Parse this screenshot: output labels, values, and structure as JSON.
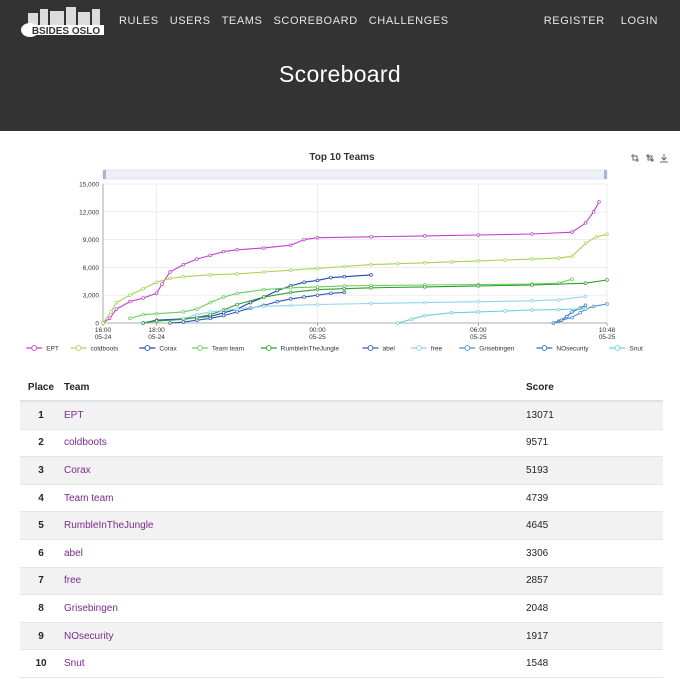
{
  "nav": {
    "left": [
      "RULES",
      "USERS",
      "TEAMS",
      "SCOREBOARD",
      "CHALLENGES"
    ],
    "right": [
      "REGISTER",
      "LOGIN"
    ]
  },
  "page_title": "Scoreboard",
  "logo": {
    "text": "BSIDES OSLO"
  },
  "table": {
    "headers": {
      "place": "Place",
      "team": "Team",
      "score": "Score"
    },
    "rows": [
      {
        "place": "1",
        "team": "EPT",
        "score": "13071"
      },
      {
        "place": "2",
        "team": "coldboots",
        "score": "9571"
      },
      {
        "place": "3",
        "team": "Corax",
        "score": "5193"
      },
      {
        "place": "4",
        "team": "Team team",
        "score": "4739"
      },
      {
        "place": "5",
        "team": "RumbleInTheJungle",
        "score": "4645"
      },
      {
        "place": "6",
        "team": "abel",
        "score": "3306"
      },
      {
        "place": "7",
        "team": "free",
        "score": "2857"
      },
      {
        "place": "8",
        "team": "Grisebingen",
        "score": "2048"
      },
      {
        "place": "9",
        "team": "NOsecurity",
        "score": "1917"
      },
      {
        "place": "10",
        "team": "Snut",
        "score": "1548"
      }
    ]
  },
  "colors": {
    "header_bg": "#333333",
    "link": "#7a2a8f",
    "stripe": "#f2f2f2"
  },
  "icons": [
    "zoom-icon",
    "zoom-reset-icon",
    "download-icon"
  ],
  "chart_data": {
    "type": "line",
    "title": "Top 10 Teams",
    "x_unit": "hours",
    "xlim": [
      0,
      18.8
    ],
    "ylim": [
      0,
      15000
    ],
    "y_ticks": [
      "0",
      "3,000",
      "6,000",
      "9,000",
      "12,000",
      "15,000"
    ],
    "y_tick_values": [
      0,
      3000,
      6000,
      9000,
      12000,
      15000
    ],
    "x_ticks": [
      {
        "x": 0,
        "time": "16:00",
        "date": "05-24"
      },
      {
        "x": 2,
        "time": "18:00",
        "date": "05-24"
      },
      {
        "x": 8,
        "time": "00:00",
        "date": "05-25"
      },
      {
        "x": 14,
        "time": "06:00",
        "date": "05-25"
      },
      {
        "x": 18.8,
        "time": "10:48",
        "date": "05-25"
      }
    ],
    "grid": true,
    "legend_position": "bottom",
    "series": [
      {
        "name": "EPT",
        "color": "#c23fd0",
        "points": [
          [
            0,
            0
          ],
          [
            0.25,
            500
          ],
          [
            0.5,
            1500
          ],
          [
            1,
            2300
          ],
          [
            1.5,
            2700
          ],
          [
            2,
            3200
          ],
          [
            2.2,
            4200
          ],
          [
            2.5,
            5500
          ],
          [
            3,
            6300
          ],
          [
            3.5,
            6900
          ],
          [
            4,
            7300
          ],
          [
            4.5,
            7700
          ],
          [
            5,
            7900
          ],
          [
            6,
            8100
          ],
          [
            7,
            8400
          ],
          [
            7.5,
            9000
          ],
          [
            8,
            9200
          ],
          [
            10,
            9300
          ],
          [
            12,
            9400
          ],
          [
            14,
            9500
          ],
          [
            16,
            9600
          ],
          [
            17.5,
            9800
          ],
          [
            18,
            10800
          ],
          [
            18.3,
            12000
          ],
          [
            18.5,
            13071
          ]
        ]
      },
      {
        "name": "coldboots",
        "color": "#a6d454",
        "points": [
          [
            0,
            0
          ],
          [
            0.3,
            1200
          ],
          [
            0.5,
            2200
          ],
          [
            1,
            3000
          ],
          [
            1.5,
            3700
          ],
          [
            2,
            4400
          ],
          [
            2.5,
            4800
          ],
          [
            3,
            5000
          ],
          [
            4,
            5200
          ],
          [
            5,
            5300
          ],
          [
            6,
            5500
          ],
          [
            7,
            5700
          ],
          [
            8,
            5900
          ],
          [
            9,
            6100
          ],
          [
            10,
            6300
          ],
          [
            11,
            6400
          ],
          [
            12,
            6500
          ],
          [
            13,
            6600
          ],
          [
            14,
            6700
          ],
          [
            15,
            6800
          ],
          [
            16,
            6900
          ],
          [
            17,
            7000
          ],
          [
            17.5,
            7200
          ],
          [
            18,
            8600
          ],
          [
            18.4,
            9300
          ],
          [
            18.8,
            9571
          ]
        ]
      },
      {
        "name": "Corax",
        "color": "#1f44b7",
        "points": [
          [
            1.5,
            0
          ],
          [
            2,
            300
          ],
          [
            3,
            450
          ],
          [
            3.5,
            600
          ],
          [
            4,
            700
          ],
          [
            4.5,
            1100
          ],
          [
            5,
            1500
          ],
          [
            5.5,
            2200
          ],
          [
            6,
            2800
          ],
          [
            6.5,
            3500
          ],
          [
            7,
            4000
          ],
          [
            7.5,
            4400
          ],
          [
            8,
            4600
          ],
          [
            8.5,
            4900
          ],
          [
            9,
            5000
          ],
          [
            10,
            5193
          ]
        ]
      },
      {
        "name": "Team team",
        "color": "#6acd5a",
        "points": [
          [
            1,
            500
          ],
          [
            1.5,
            900
          ],
          [
            2,
            1000
          ],
          [
            3,
            1200
          ],
          [
            3.5,
            1500
          ],
          [
            4,
            2200
          ],
          [
            4.5,
            2800
          ],
          [
            5,
            3200
          ],
          [
            6,
            3600
          ],
          [
            7,
            3800
          ],
          [
            8,
            3900
          ],
          [
            9,
            4000
          ],
          [
            10,
            4050
          ],
          [
            12,
            4100
          ],
          [
            14,
            4150
          ],
          [
            16,
            4200
          ],
          [
            17,
            4300
          ],
          [
            17.5,
            4739
          ]
        ]
      },
      {
        "name": "RumbleInTheJungle",
        "color": "#2e9e2b",
        "points": [
          [
            1.5,
            0
          ],
          [
            2,
            200
          ],
          [
            3,
            400
          ],
          [
            3.5,
            600
          ],
          [
            4,
            900
          ],
          [
            4.5,
            1400
          ],
          [
            5,
            2000
          ],
          [
            6,
            2800
          ],
          [
            7,
            3300
          ],
          [
            8,
            3600
          ],
          [
            9,
            3700
          ],
          [
            10,
            3800
          ],
          [
            12,
            3900
          ],
          [
            14,
            4000
          ],
          [
            16,
            4100
          ],
          [
            18,
            4300
          ],
          [
            18.8,
            4645
          ]
        ]
      },
      {
        "name": "abel",
        "color": "#2e59b0",
        "points": [
          [
            2.5,
            0
          ],
          [
            3,
            100
          ],
          [
            3.5,
            300
          ],
          [
            4,
            500
          ],
          [
            4.5,
            800
          ],
          [
            5,
            1200
          ],
          [
            5.5,
            1600
          ],
          [
            6,
            1900
          ],
          [
            6.5,
            2300
          ],
          [
            7,
            2600
          ],
          [
            7.5,
            2800
          ],
          [
            8,
            3000
          ],
          [
            8.5,
            3200
          ],
          [
            9,
            3306
          ]
        ]
      },
      {
        "name": "free",
        "color": "#8fd4f0",
        "points": [
          [
            3,
            500
          ],
          [
            3.5,
            900
          ],
          [
            4,
            1200
          ],
          [
            5,
            1500
          ],
          [
            6,
            1800
          ],
          [
            7,
            1900
          ],
          [
            8,
            2000
          ],
          [
            10,
            2100
          ],
          [
            12,
            2200
          ],
          [
            14,
            2300
          ],
          [
            16,
            2400
          ],
          [
            17,
            2500
          ],
          [
            18,
            2857
          ]
        ]
      },
      {
        "name": "Grisebingen",
        "color": "#4a8fd0",
        "points": [
          [
            17,
            200
          ],
          [
            17.5,
            600
          ],
          [
            17.8,
            1100
          ],
          [
            18,
            1500
          ],
          [
            18.3,
            1800
          ],
          [
            18.8,
            2048
          ]
        ]
      },
      {
        "name": "NOsecurity",
        "color": "#2a6fc2",
        "points": [
          [
            16.8,
            0
          ],
          [
            17.1,
            300
          ],
          [
            17.3,
            700
          ],
          [
            17.5,
            1200
          ],
          [
            17.8,
            1600
          ],
          [
            18,
            1917
          ]
        ]
      },
      {
        "name": "Snut",
        "color": "#6ad0dd",
        "points": [
          [
            11,
            0
          ],
          [
            11.5,
            400
          ],
          [
            12,
            800
          ],
          [
            13,
            1100
          ],
          [
            14,
            1200
          ],
          [
            15,
            1300
          ],
          [
            16,
            1400
          ],
          [
            17,
            1450
          ],
          [
            18,
            1548
          ]
        ]
      }
    ]
  }
}
